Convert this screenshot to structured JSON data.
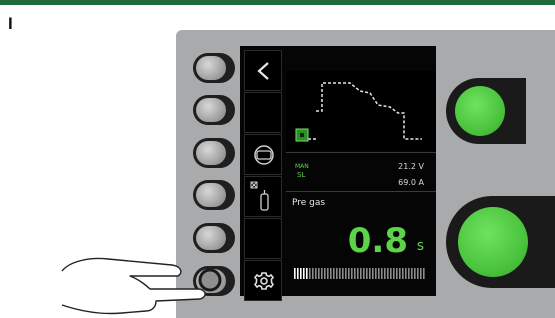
{
  "figure_label": "I",
  "display": {
    "parameter_label": "Pre gas",
    "parameter_value": "0.8",
    "parameter_unit": "s",
    "voltage": "21.2 V",
    "current": "69.0 A",
    "mode_text_top": "MAN",
    "mode_text_bottom": "SL",
    "progress_fraction": 0.12
  },
  "colors": {
    "accent": "#5dd34a",
    "panel": "#a8aaac",
    "header_bar": "#1f6b3a"
  },
  "menu": {
    "items": [
      {
        "icon": "back-chevron-icon"
      },
      {
        "icon": "blank"
      },
      {
        "icon": "wire-spool-icon"
      },
      {
        "icon": "gas-bottle-icon"
      },
      {
        "icon": "blank"
      },
      {
        "icon": "settings-gear-icon"
      }
    ]
  }
}
